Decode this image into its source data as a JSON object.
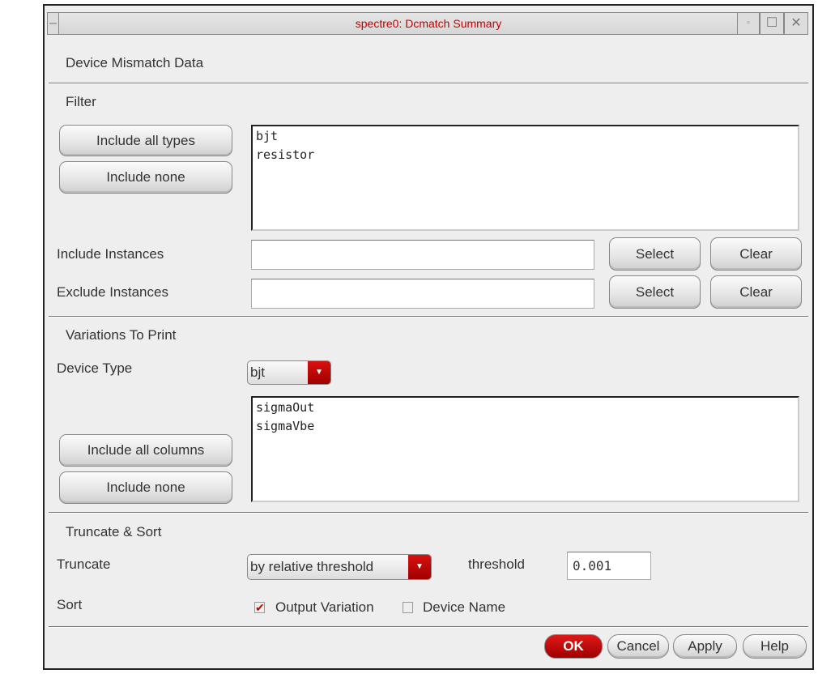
{
  "window": {
    "title": "spectre0: Dcmatch Summary"
  },
  "header": "Device Mismatch Data",
  "filter": {
    "heading": "Filter",
    "include_all_types": "Include all types",
    "include_none": "Include none",
    "types": [
      "bjt",
      "resistor"
    ],
    "include_instances_label": "Include Instances",
    "include_instances_value": "",
    "exclude_instances_label": "Exclude Instances",
    "exclude_instances_value": "",
    "select": "Select",
    "clear": "Clear"
  },
  "variations": {
    "heading": "Variations To Print",
    "device_type_label": "Device Type",
    "device_type_value": "bjt",
    "columns": [
      "sigmaOut",
      "sigmaVbe"
    ],
    "include_all_columns": "Include all columns",
    "include_none": "Include none"
  },
  "truncate_sort": {
    "heading": "Truncate & Sort",
    "truncate_label": "Truncate",
    "truncate_value": "by relative threshold",
    "threshold_label": "threshold",
    "threshold_value": "0.001",
    "sort_label": "Sort",
    "output_variation": "Output Variation",
    "output_variation_checked": true,
    "device_name": "Device Name",
    "device_name_checked": false
  },
  "footer": {
    "ok": "OK",
    "cancel": "Cancel",
    "apply": "Apply",
    "help": "Help"
  },
  "colors": {
    "accent": "#c00000"
  }
}
